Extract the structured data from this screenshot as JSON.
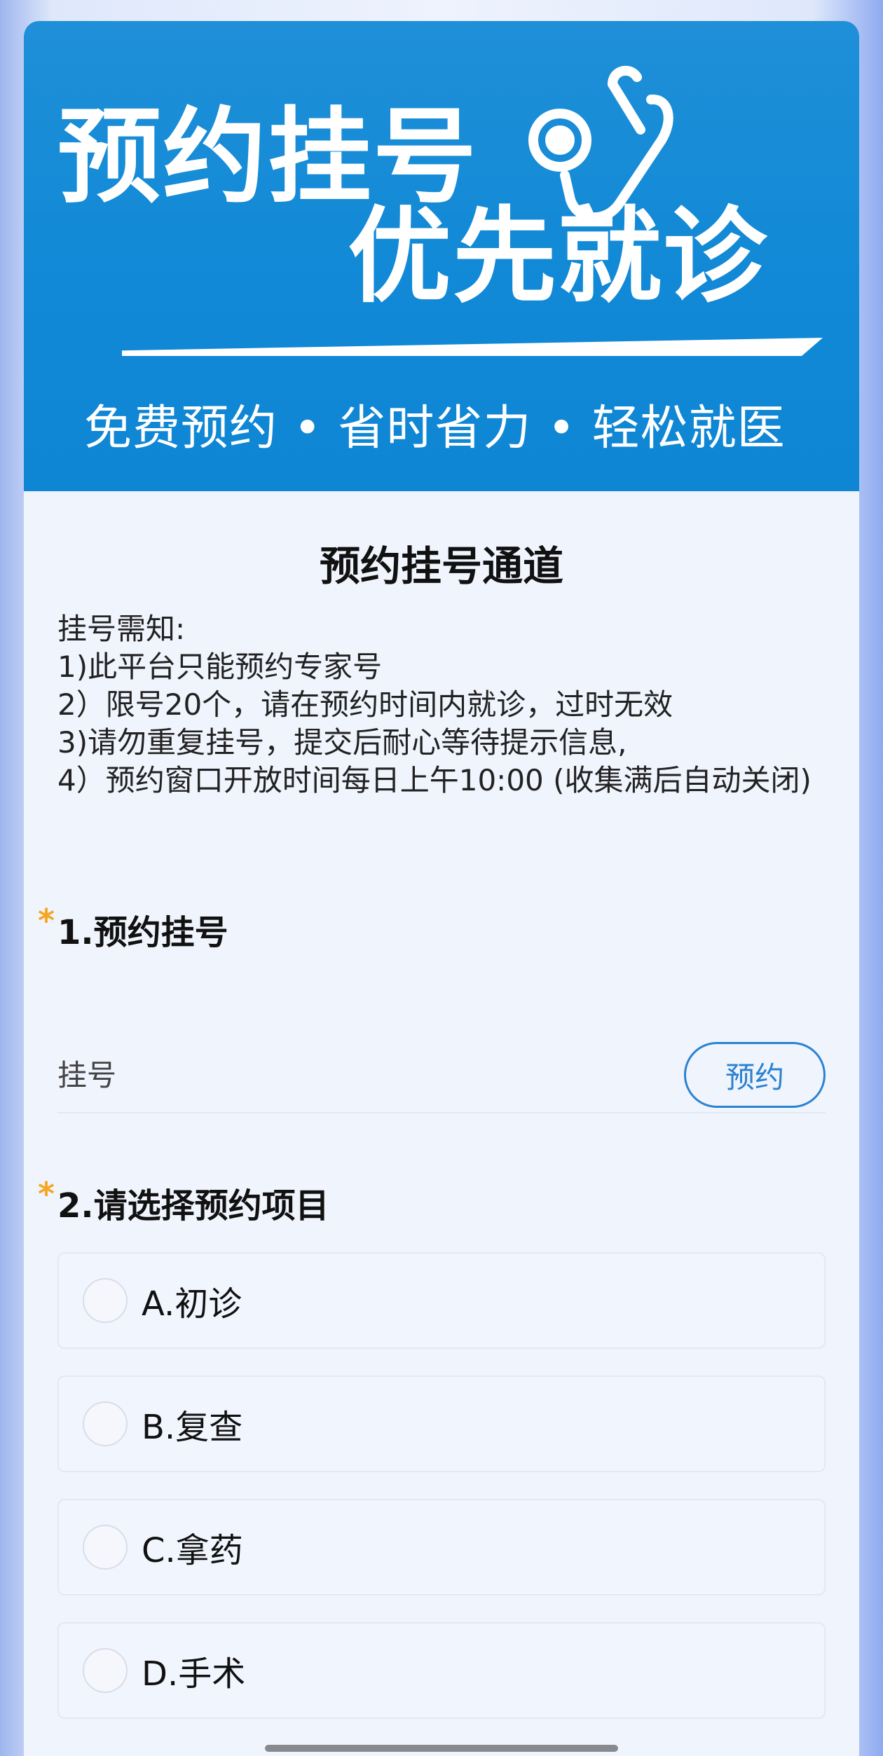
{
  "banner": {
    "line1": "预约挂号",
    "line2": "优先就诊",
    "subtitle": "免费预约 • 省时省力 • 轻松就医",
    "icon": "stethoscope-icon",
    "bg_color": "#1189d6"
  },
  "page_title": "预约挂号通道",
  "notice": {
    "heading": "挂号需知:",
    "items": [
      "1)此平台只能预约专家号",
      "2）限号20个，请在预约时间内就诊，过时无效",
      "3)请勿重复挂号，提交后耐心等待提示信息,",
      "4）预约窗口开放时间每日上午10:00 (收集满后自动关闭)"
    ]
  },
  "questions": [
    {
      "required_mark": "*",
      "title": "1.预约挂号",
      "row_label": "挂号",
      "button_label": "预约"
    },
    {
      "required_mark": "*",
      "title": "2.请选择预约项目",
      "options": [
        "A.初诊",
        "B.复查",
        "C.拿药",
        "D.手术"
      ]
    }
  ],
  "colors": {
    "accent": "#2a82d2",
    "required_star": "#f5a623"
  }
}
